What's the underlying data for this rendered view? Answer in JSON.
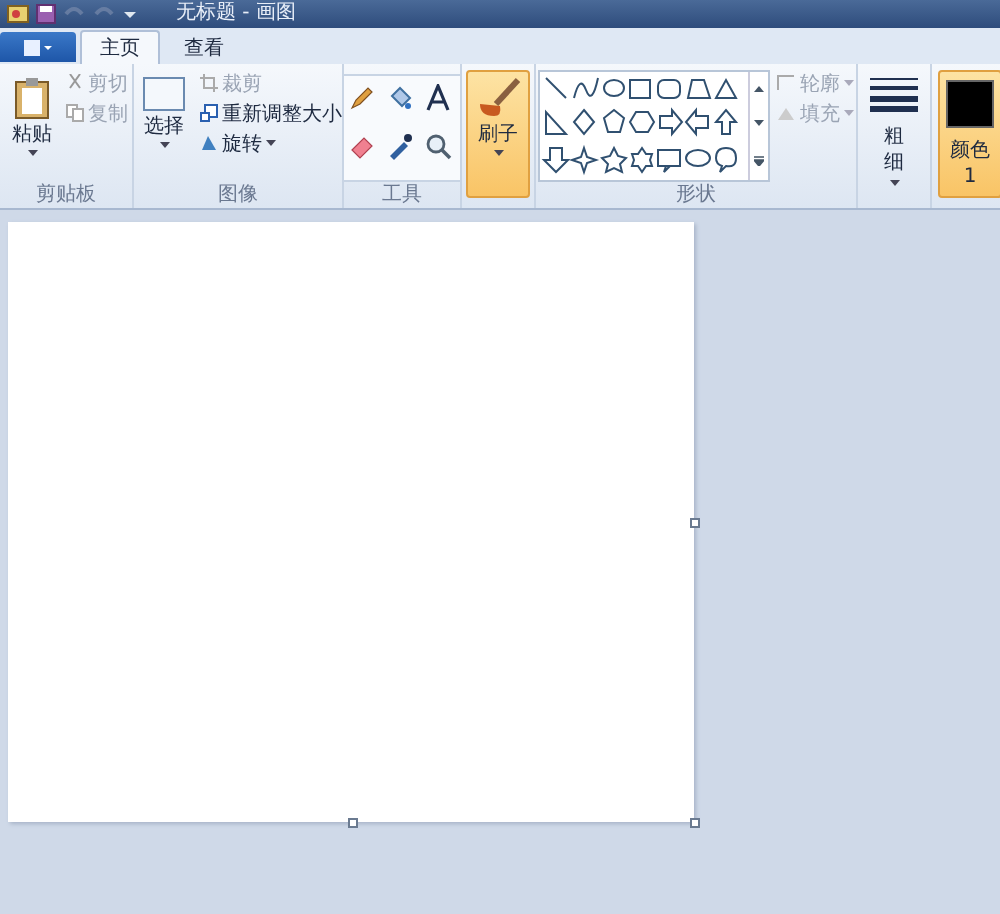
{
  "window": {
    "title": "无标题 - 画图"
  },
  "tabs": [
    {
      "label": "主页",
      "selected": true
    },
    {
      "label": "查看",
      "selected": false
    }
  ],
  "ribbon": {
    "clipboard": {
      "label": "剪贴板",
      "paste": "粘贴",
      "cut": "剪切",
      "copy": "复制"
    },
    "image": {
      "label": "图像",
      "select": "选择",
      "crop": "裁剪",
      "resize": "重新调整大小",
      "rotate": "旋转"
    },
    "tools": {
      "label": "工具"
    },
    "brushes": {
      "label": "刷子"
    },
    "shapes": {
      "label": "形状",
      "outline": "轮廓",
      "fill": "填充"
    },
    "size": {
      "label": "粗细"
    },
    "color1": {
      "label": "颜色 1",
      "color": "#000000"
    }
  }
}
